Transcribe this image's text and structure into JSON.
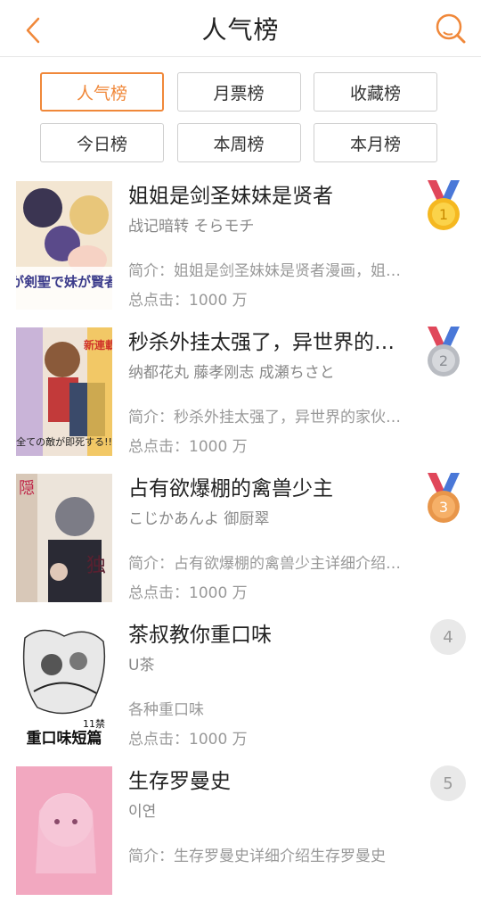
{
  "header": {
    "title": "人气榜",
    "back_icon": "chevron-left-icon",
    "search_icon": "search-icon",
    "accent": "#f0883a"
  },
  "filters": {
    "row1": [
      "人气榜",
      "月票榜",
      "收藏榜"
    ],
    "row2": [
      "今日榜",
      "本周榜",
      "本月榜"
    ],
    "active": "人气榜"
  },
  "items": [
    {
      "title": "姐姐是剑圣妹妹是贤者",
      "author": "战记暗转 そらモチ",
      "desc": "简介：姐姐是剑圣妹妹是贤者漫画，姐姐是剑圣妹妹是贤者",
      "clicks": "总点击：1000 万",
      "rank": "1",
      "medal": "gold",
      "cover_text": "姉が剣聖で妹が賢者で",
      "cover_color": "#d8b86a"
    },
    {
      "title": "秒杀外挂太强了，异世界的家伙们根本就不是对手",
      "author": "纳都花丸 藤孝刚志 成瀬ちさと",
      "desc": "简介：秒杀外挂太强了，异世界的家伙们根本就不是对手",
      "clicks": "总点击：1000 万",
      "rank": "2",
      "medal": "silver",
      "cover_text": "新連載スタート",
      "cover_color": "#c9a07a"
    },
    {
      "title": "占有欲爆棚的禽兽少主",
      "author": "こじかあんよ 御厨翠",
      "desc": "简介：占有欲爆棚的禽兽少主详细介绍占有欲爆棚的禽兽少主",
      "clicks": "总点击：1000 万",
      "rank": "3",
      "medal": "bronze",
      "cover_text": "隠さない独占欲",
      "cover_color": "#a9998a"
    },
    {
      "title": "茶叔教你重口味",
      "author": "U茶",
      "desc": "各种重口味",
      "clicks": "总点击：1000 万",
      "rank": "4",
      "medal": "",
      "cover_text": "重口味短篇",
      "cover_sub": "11禁",
      "cover_color": "#ffffff"
    },
    {
      "title": "生存罗曼史",
      "author": "이연",
      "desc": "简介：生存罗曼史详细介绍生存罗曼史",
      "clicks": "",
      "rank": "5",
      "medal": "",
      "cover_text": "",
      "cover_color": "#e890a8"
    }
  ]
}
